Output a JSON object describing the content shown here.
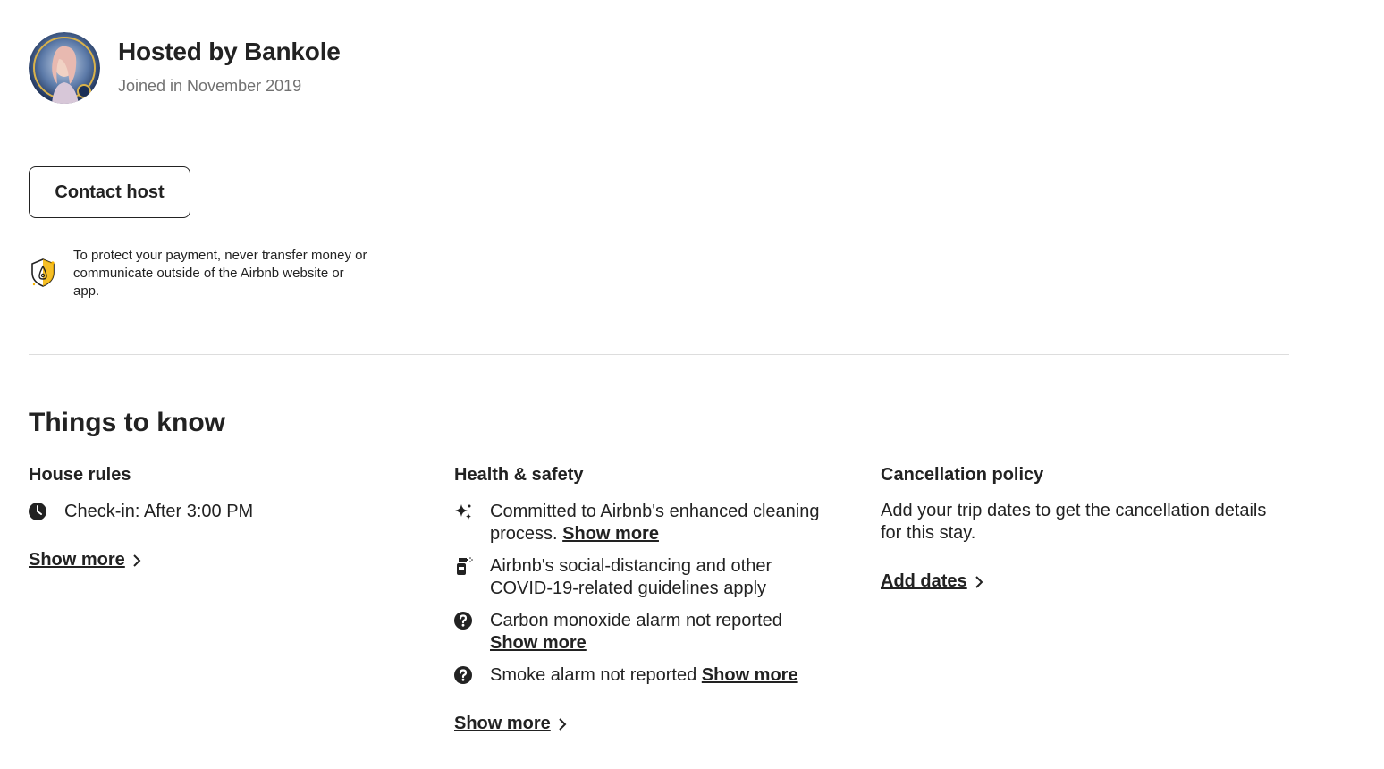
{
  "host": {
    "title": "Hosted by Bankole",
    "joined": "Joined in November 2019",
    "avatar_icon": "host-avatar-photo"
  },
  "contact_button": {
    "label": "Contact host"
  },
  "payment_notice": {
    "icon": "shield-icon",
    "text": "To protect your payment, never transfer money or communicate outside of the Airbnb website or app."
  },
  "things_to_know": {
    "title": "Things to know",
    "house_rules": {
      "title": "House rules",
      "items": [
        {
          "icon": "clock-icon",
          "text": "Check-in: After 3:00 PM"
        }
      ],
      "show_more": "Show more"
    },
    "health_safety": {
      "title": "Health & safety",
      "items": [
        {
          "icon": "sparkles-icon",
          "text": "Committed to Airbnb's enhanced cleaning process.",
          "link": "Show more"
        },
        {
          "icon": "spray-bottle-icon",
          "text": "Airbnb's social-distancing and other COVID-19-related guidelines apply",
          "link": ""
        },
        {
          "icon": "question-circle-icon",
          "text": "Carbon monoxide alarm not reported",
          "link": "Show more"
        },
        {
          "icon": "question-circle-icon",
          "text": "Smoke alarm not reported",
          "link": "Show more"
        }
      ],
      "show_more": "Show more"
    },
    "cancellation": {
      "title": "Cancellation policy",
      "text": "Add your trip dates to get the cancellation details for this stay.",
      "link": "Add dates"
    }
  },
  "colors": {
    "text": "#222222",
    "muted": "#717171",
    "divider": "#dddddd",
    "shield_accent": "#f5b400"
  }
}
